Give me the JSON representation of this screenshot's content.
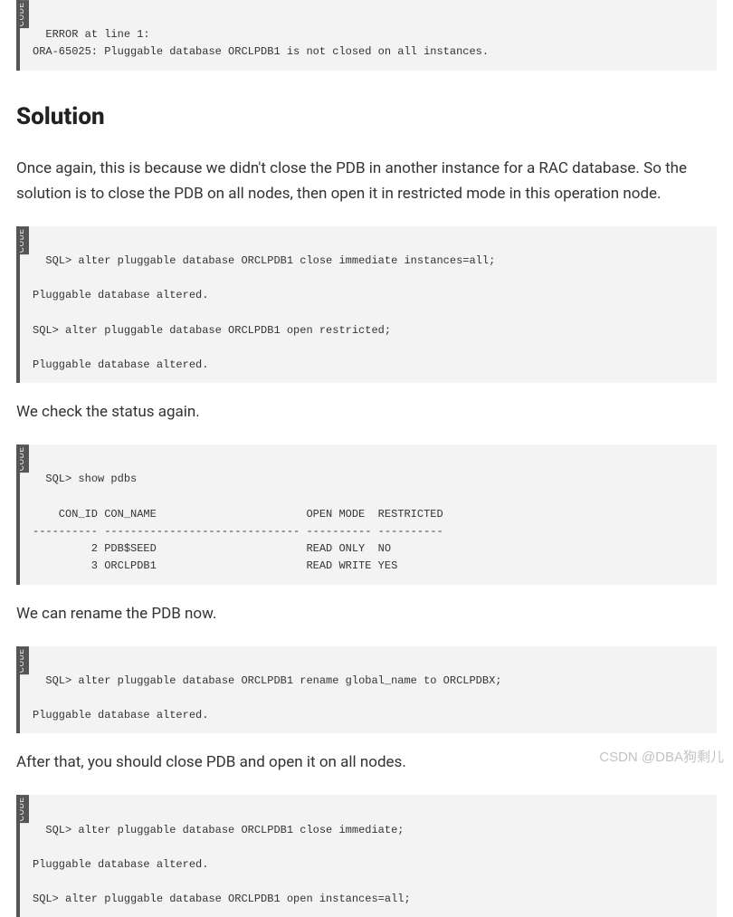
{
  "code_label": "CODE",
  "block1": "ERROR at line 1:\nORA-65025: Pluggable database ORCLPDB1 is not closed on all instances.",
  "heading": "Solution",
  "para1": "Once again, this is because we didn't close the PDB in another instance for a RAC database. So the solution is to close the PDB on all nodes, then open it in restricted mode in this operation node.",
  "block2": "SQL> alter pluggable database ORCLPDB1 close immediate instances=all;\n\nPluggable database altered.\n\nSQL> alter pluggable database ORCLPDB1 open restricted;\n\nPluggable database altered.",
  "para2": "We check the status again.",
  "block3": "SQL> show pdbs\n\n    CON_ID CON_NAME                       OPEN MODE  RESTRICTED\n---------- ------------------------------ ---------- ----------\n         2 PDB$SEED                       READ ONLY  NO\n         3 ORCLPDB1                       READ WRITE YES",
  "para3": "We can rename the PDB now.",
  "block4": "SQL> alter pluggable database ORCLPDB1 rename global_name to ORCLPDBX;\n\nPluggable database altered.",
  "para4": "After that, you should close PDB and open it on all nodes.",
  "block5": "SQL> alter pluggable database ORCLPDB1 close immediate;\n\nPluggable database altered.\n\nSQL> alter pluggable database ORCLPDB1 open instances=all;",
  "watermark": "CSDN @DBA狗剩儿"
}
